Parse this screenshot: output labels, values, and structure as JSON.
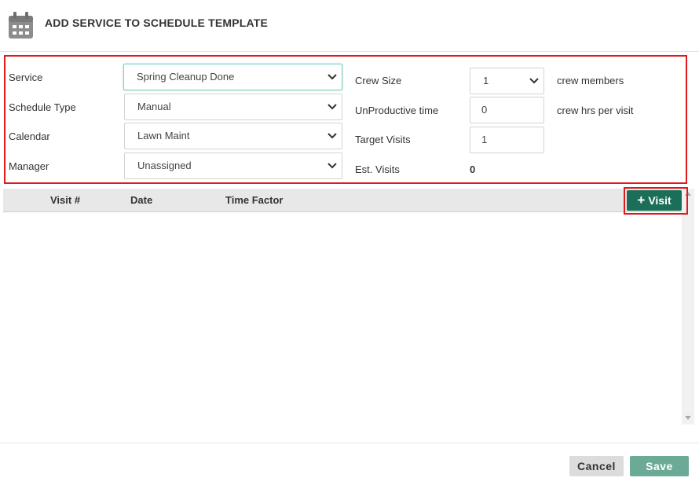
{
  "header": {
    "title": "ADD SERVICE TO SCHEDULE TEMPLATE",
    "icon": "calendar-icon"
  },
  "form": {
    "service": {
      "label": "Service",
      "value": "Spring Cleanup Done"
    },
    "schedule_type": {
      "label": "Schedule Type",
      "value": "Manual"
    },
    "calendar": {
      "label": "Calendar",
      "value": "Lawn Maint"
    },
    "manager": {
      "label": "Manager",
      "value": "Unassigned"
    },
    "crew_size": {
      "label": "Crew Size",
      "value": "1",
      "unit": "crew members"
    },
    "unproductive_time": {
      "label": "UnProductive time",
      "value": "0",
      "unit": "crew hrs per visit"
    },
    "target_visits": {
      "label": "Target Visits",
      "value": "1"
    },
    "est_visits": {
      "label": "Est. Visits",
      "value": "0"
    }
  },
  "table": {
    "columns": [
      "Visit #",
      "Date",
      "Time Factor"
    ],
    "add_visit_label": "Visit",
    "rows": []
  },
  "footer": {
    "cancel_label": "Cancel",
    "save_label": "Save"
  },
  "colors": {
    "accent": "#1b6e58",
    "save": "#6aaa96",
    "highlight": "#e0191d"
  }
}
